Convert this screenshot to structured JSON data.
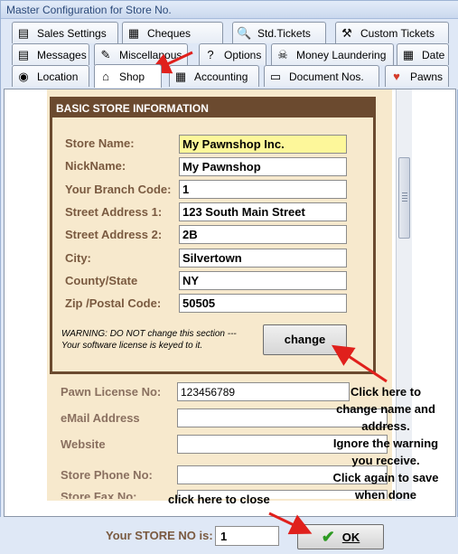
{
  "window": {
    "title": "Master Configuration for Store No."
  },
  "tabs": {
    "row1": [
      {
        "label": "Sales Settings",
        "icon": "sales-settings-icon",
        "glyph": "▤"
      },
      {
        "label": "Cheques",
        "icon": "cheques-icon",
        "glyph": "▦"
      },
      {
        "label": "Std.Tickets",
        "icon": "tickets-icon",
        "glyph": "🔍"
      },
      {
        "label": "Custom Tickets",
        "icon": "tools-icon",
        "glyph": "⚒"
      }
    ],
    "row2": [
      {
        "label": "Messages",
        "icon": "messages-icon",
        "glyph": "▤"
      },
      {
        "label": "Miscellanous",
        "icon": "pencil-icon",
        "glyph": "✎"
      },
      {
        "label": "Options",
        "icon": "question-icon",
        "glyph": "?"
      },
      {
        "label": "Money Laundering",
        "icon": "skull-icon",
        "glyph": "☠"
      },
      {
        "label": "Date",
        "icon": "calendar-icon",
        "glyph": "▦"
      }
    ],
    "row3": [
      {
        "label": "Location",
        "icon": "globe-icon",
        "glyph": "◉"
      },
      {
        "label": "Shop",
        "icon": "home-icon",
        "glyph": "⌂"
      },
      {
        "label": "Accounting",
        "icon": "calculator-icon",
        "glyph": "▦"
      },
      {
        "label": "Document Nos.",
        "icon": "document-icon",
        "glyph": "▭"
      },
      {
        "label": "Pawns",
        "icon": "hearts-icon",
        "glyph": "♥"
      }
    ]
  },
  "basic": {
    "header": "BASIC STORE INFORMATION",
    "fields": [
      {
        "label": "Store Name:",
        "value": "My Pawnshop Inc."
      },
      {
        "label": "NickName:",
        "value": "My Pawnshop"
      },
      {
        "label": "Your Branch Code:",
        "value": "1"
      },
      {
        "label": "Street Address 1:",
        "value": "123 South Main Street"
      },
      {
        "label": "Street Address 2:",
        "value": "2B"
      },
      {
        "label": "City:",
        "value": "Silvertown"
      },
      {
        "label": "County/State",
        "value": "NY"
      },
      {
        "label": "Zip /Postal Code:",
        "value": "50505"
      }
    ],
    "warning_line1": "WARNING: DO NOT change this section ---",
    "warning_line2": "Your software license is keyed to it.",
    "change_label": "change"
  },
  "extra": {
    "fields": [
      {
        "label": "Pawn License No:",
        "value": "123456789"
      },
      {
        "label": "eMail Address",
        "value": ""
      },
      {
        "label": "Website",
        "value": ""
      },
      {
        "label": "Store Phone No:",
        "value": ""
      },
      {
        "label": "Store Fax No:",
        "value": ""
      }
    ]
  },
  "annotations": {
    "change_note": [
      "Click here to",
      "change name and",
      "address.",
      "Ignore the warning",
      "you receive.",
      "Click again to save",
      "when done"
    ],
    "close_note": "click here to close"
  },
  "footer": {
    "store_no_label": "Your STORE NO is:",
    "store_no_value": "1",
    "ok_label": "OK"
  },
  "colors": {
    "arrow": "#e0201c",
    "panel": "#f7e9cd",
    "header": "#6b4a2f"
  }
}
